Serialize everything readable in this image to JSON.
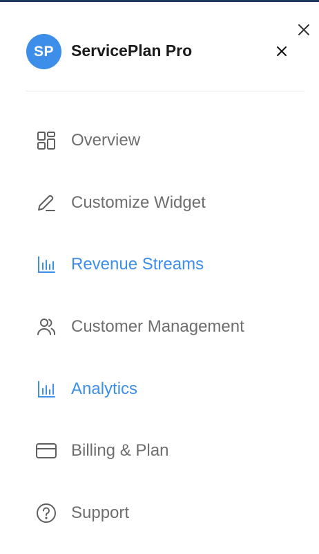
{
  "header": {
    "avatar_initials": "SP",
    "title": "ServicePlan Pro"
  },
  "icons": {
    "close": "close-icon",
    "overview": "grid-icon",
    "customize": "pencil-icon",
    "revenue": "bar-chart-icon",
    "customers": "users-icon",
    "analytics": "bar-chart-icon",
    "billing": "credit-card-icon",
    "support": "help-circle-icon"
  },
  "colors": {
    "accent": "#3d8ee8",
    "text_muted": "#6e6e6e",
    "title": "#1a1a1a",
    "top_border": "#1f3b63"
  },
  "nav": {
    "items": [
      {
        "label": "Overview",
        "active": false
      },
      {
        "label": "Customize Widget",
        "active": false
      },
      {
        "label": "Revenue Streams",
        "active": true
      },
      {
        "label": "Customer Management",
        "active": false
      },
      {
        "label": "Analytics",
        "active": true
      },
      {
        "label": "Billing & Plan",
        "active": false
      },
      {
        "label": "Support",
        "active": false
      }
    ]
  }
}
